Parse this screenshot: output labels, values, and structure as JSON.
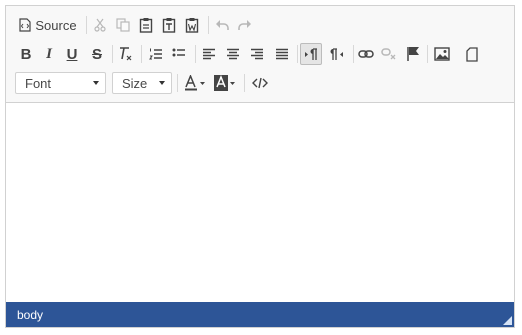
{
  "toolbar": {
    "source_label": "Source",
    "font_combo": {
      "value": "Font"
    },
    "size_combo": {
      "value": "Size"
    }
  },
  "statusbar": {
    "path": "body"
  },
  "colors": {
    "statusbar_bg": "#2d5597",
    "border": "#d1d1d1",
    "toolbar_bg": "#f8f8f8"
  },
  "icons": {
    "row1": [
      "source-icon",
      "cut-icon",
      "copy-icon",
      "paste-icon",
      "paste-text-icon",
      "paste-word-icon",
      "undo-icon",
      "redo-icon"
    ],
    "row2": [
      "bold-icon",
      "italic-icon",
      "underline-icon",
      "strikethrough-icon",
      "remove-format-icon",
      "numbered-list-icon",
      "bulleted-list-icon",
      "align-left-icon",
      "align-center-icon",
      "align-right-icon",
      "justify-icon",
      "ltr-icon",
      "rtl-icon",
      "link-icon",
      "unlink-icon",
      "anchor-icon",
      "image-icon",
      "page-icon"
    ],
    "row3": [
      "text-color-icon",
      "background-color-icon",
      "code-icon"
    ]
  }
}
